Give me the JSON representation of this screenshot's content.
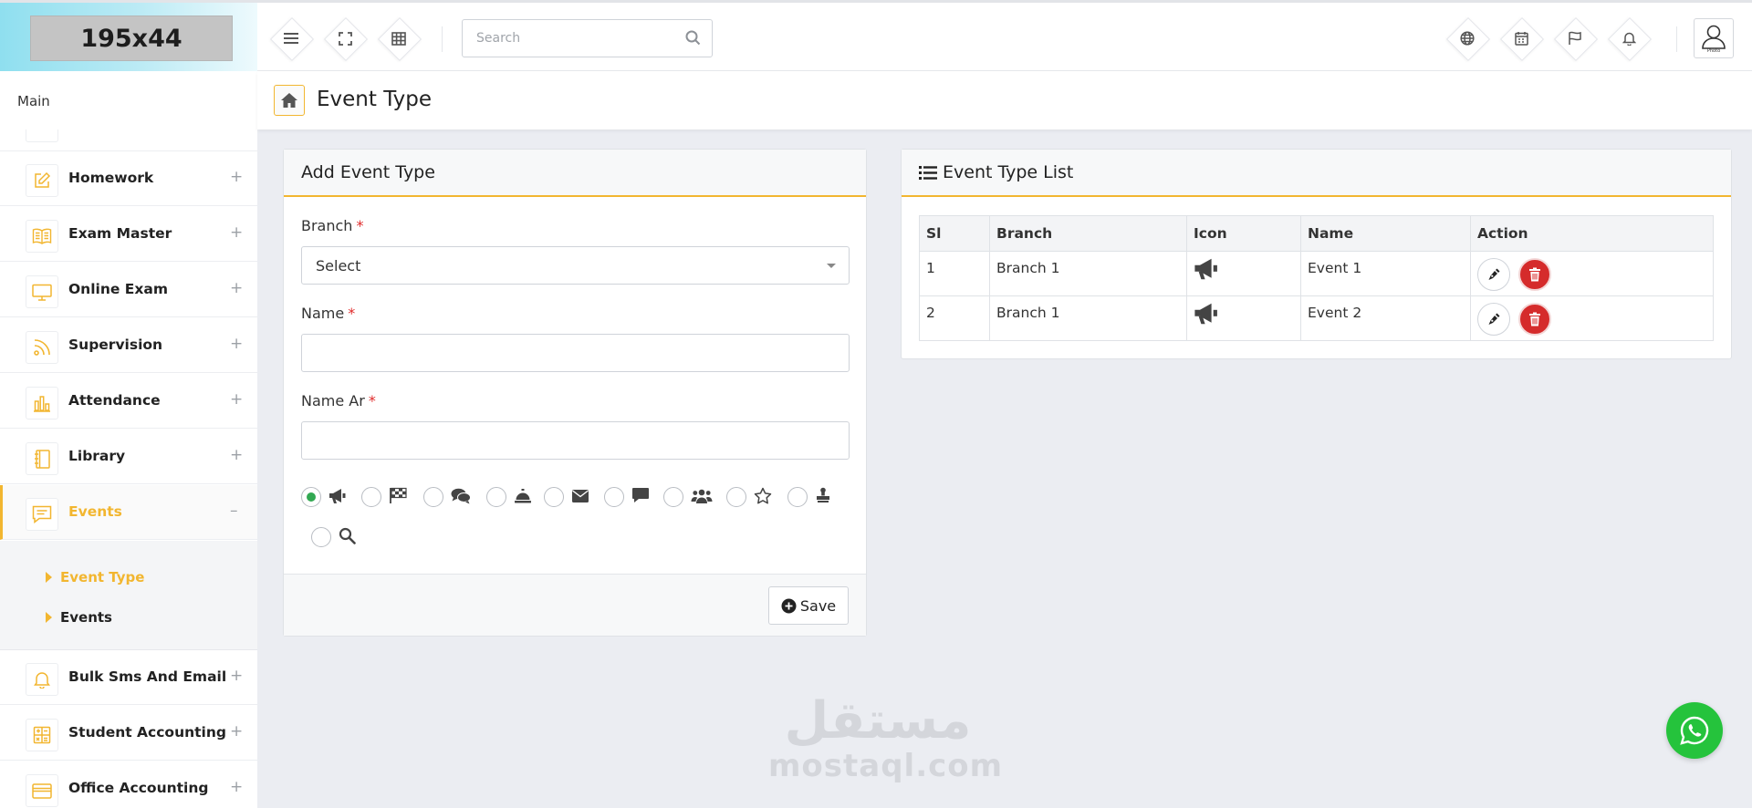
{
  "brand": {
    "logo_text": "195x44"
  },
  "topbar": {
    "search_placeholder": "Search",
    "avatar_caption": "Photo"
  },
  "sidebar": {
    "section_label": "Main",
    "items": [
      {
        "label": "Homework",
        "expander": "+",
        "icon": "edit-icon"
      },
      {
        "label": "Exam Master",
        "expander": "+",
        "icon": "book-icon"
      },
      {
        "label": "Online Exam",
        "expander": "+",
        "icon": "monitor-icon"
      },
      {
        "label": "Supervision",
        "expander": "+",
        "icon": "rss-icon"
      },
      {
        "label": "Attendance",
        "expander": "+",
        "icon": "bar-chart-icon"
      },
      {
        "label": "Library",
        "expander": "+",
        "icon": "notebook-icon"
      },
      {
        "label": "Events",
        "expander": "–",
        "icon": "message-icon",
        "active": true
      },
      {
        "label": "Bulk Sms And Email",
        "expander": "+",
        "icon": "bell-icon"
      },
      {
        "label": "Student Accounting",
        "expander": "+",
        "icon": "calculator-icon"
      },
      {
        "label": "Office Accounting",
        "expander": "+",
        "icon": "credit-card-icon"
      }
    ],
    "events_sub": [
      {
        "label": "Event Type",
        "active": true
      },
      {
        "label": "Events",
        "active": false
      }
    ]
  },
  "page": {
    "title": "Event Type"
  },
  "add_panel": {
    "title": "Add Event Type",
    "branch_label": "Branch",
    "branch_value": "Select",
    "name_label": "Name",
    "name_ar_label": "Name Ar",
    "required_mark": "*",
    "icon_options": [
      "bullhorn",
      "flag-checkered",
      "comments",
      "bell-concierge",
      "envelope",
      "comment",
      "users",
      "star",
      "stamp",
      "search"
    ],
    "selected_icon": "bullhorn",
    "save_label": "Save"
  },
  "list_panel": {
    "title": "Event Type List",
    "columns": [
      "Sl",
      "Branch",
      "Icon",
      "Name",
      "Action"
    ],
    "rows": [
      {
        "sl": "1",
        "branch": "Branch 1",
        "icon": "bullhorn",
        "name": "Event 1"
      },
      {
        "sl": "2",
        "branch": "Branch 1",
        "icon": "bullhorn",
        "name": "Event 2"
      }
    ]
  },
  "watermark": {
    "arabic": "مستقل",
    "latin": "mostaql.com"
  },
  "colors": {
    "accent": "#f2b630",
    "danger": "#d52b2b",
    "success": "#32a852",
    "whatsapp": "#25c33c",
    "brand_gradient_start": "#8fdfef"
  }
}
